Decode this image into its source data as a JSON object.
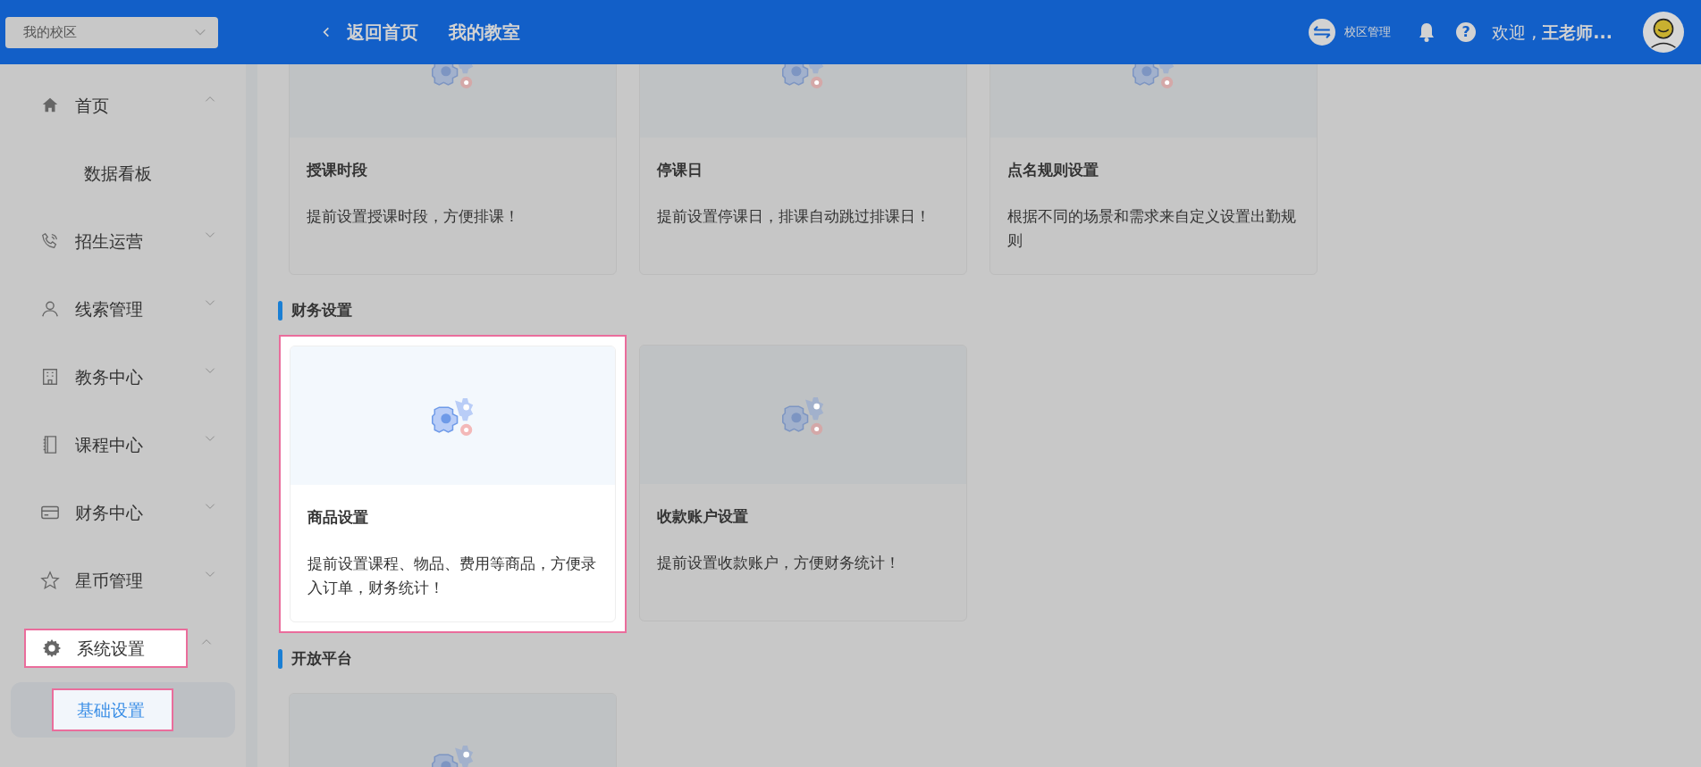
{
  "campus_select": {
    "value": "我的校区"
  },
  "header": {
    "back_link": "返回首页",
    "title": "我的教室",
    "campus_manage": "校区管理",
    "help": "?",
    "welcome": "欢迎 , **王老师...**"
  },
  "sidebar": {
    "items": [
      {
        "label": "首页",
        "expanded": true,
        "highlighted": false,
        "children": [
          {
            "label": "数据看板",
            "selected": false,
            "highlighted": false
          }
        ]
      },
      {
        "label": "招生运营",
        "expanded": false,
        "highlighted": false
      },
      {
        "label": "线索管理",
        "expanded": false,
        "highlighted": false
      },
      {
        "label": "教务中心",
        "expanded": false,
        "highlighted": false
      },
      {
        "label": "课程中心",
        "expanded": false,
        "highlighted": false
      },
      {
        "label": "财务中心",
        "expanded": false,
        "highlighted": false
      },
      {
        "label": "星币管理",
        "expanded": false,
        "highlighted": false
      },
      {
        "label": "系统设置",
        "expanded": true,
        "highlighted": true,
        "children": [
          {
            "label": "基础设置",
            "selected": true,
            "highlighted": true
          }
        ]
      }
    ]
  },
  "sections": [
    {
      "cards": [
        {
          "title": "授课时段",
          "description": "提前设置授课时段，方便排课！",
          "highlighted": false
        },
        {
          "title": "停课日",
          "description": "提前设置停课日，排课自动跳过排课日！",
          "highlighted": false
        },
        {
          "title": "点名规则设置",
          "description": "根据不同的场景和需求来自定义设置出勤规则",
          "highlighted": false
        }
      ]
    },
    {
      "title": "财务设置",
      "cards": [
        {
          "title": "商品设置",
          "description": "提前设置课程、物品、费用等商品，方便录入订单，财务统计！",
          "highlighted": true
        },
        {
          "title": "收款账户设置",
          "description": "提前设置收款账户，方便财务统计！",
          "highlighted": false
        }
      ]
    },
    {
      "title": "开放平台",
      "cards": [
        {
          "highlighted": false
        }
      ]
    }
  ]
}
